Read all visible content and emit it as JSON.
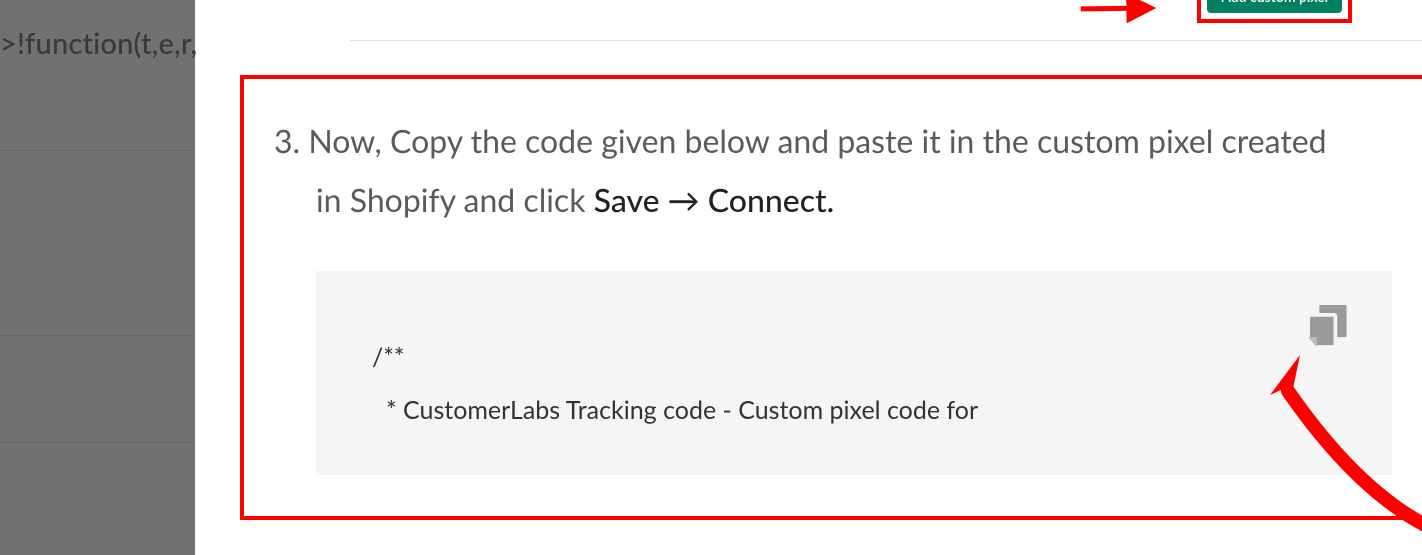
{
  "left_panel": {
    "code_fragment": ">!function(t,e,r,"
  },
  "top_button": {
    "label": "Add custom pixel"
  },
  "instruction": {
    "number": "3.",
    "line1_part1": "Now, Copy the code given below and paste it in the custom pixel created",
    "line2_prefix": "in Shopify and click ",
    "line2_strong1": "Save",
    "line2_arrow": " → ",
    "line2_strong2": "Connect",
    "line2_period": "."
  },
  "code_block": {
    "line1": "/**",
    "line2": "* CustomerLabs Tracking code - Custom pixel code for"
  }
}
